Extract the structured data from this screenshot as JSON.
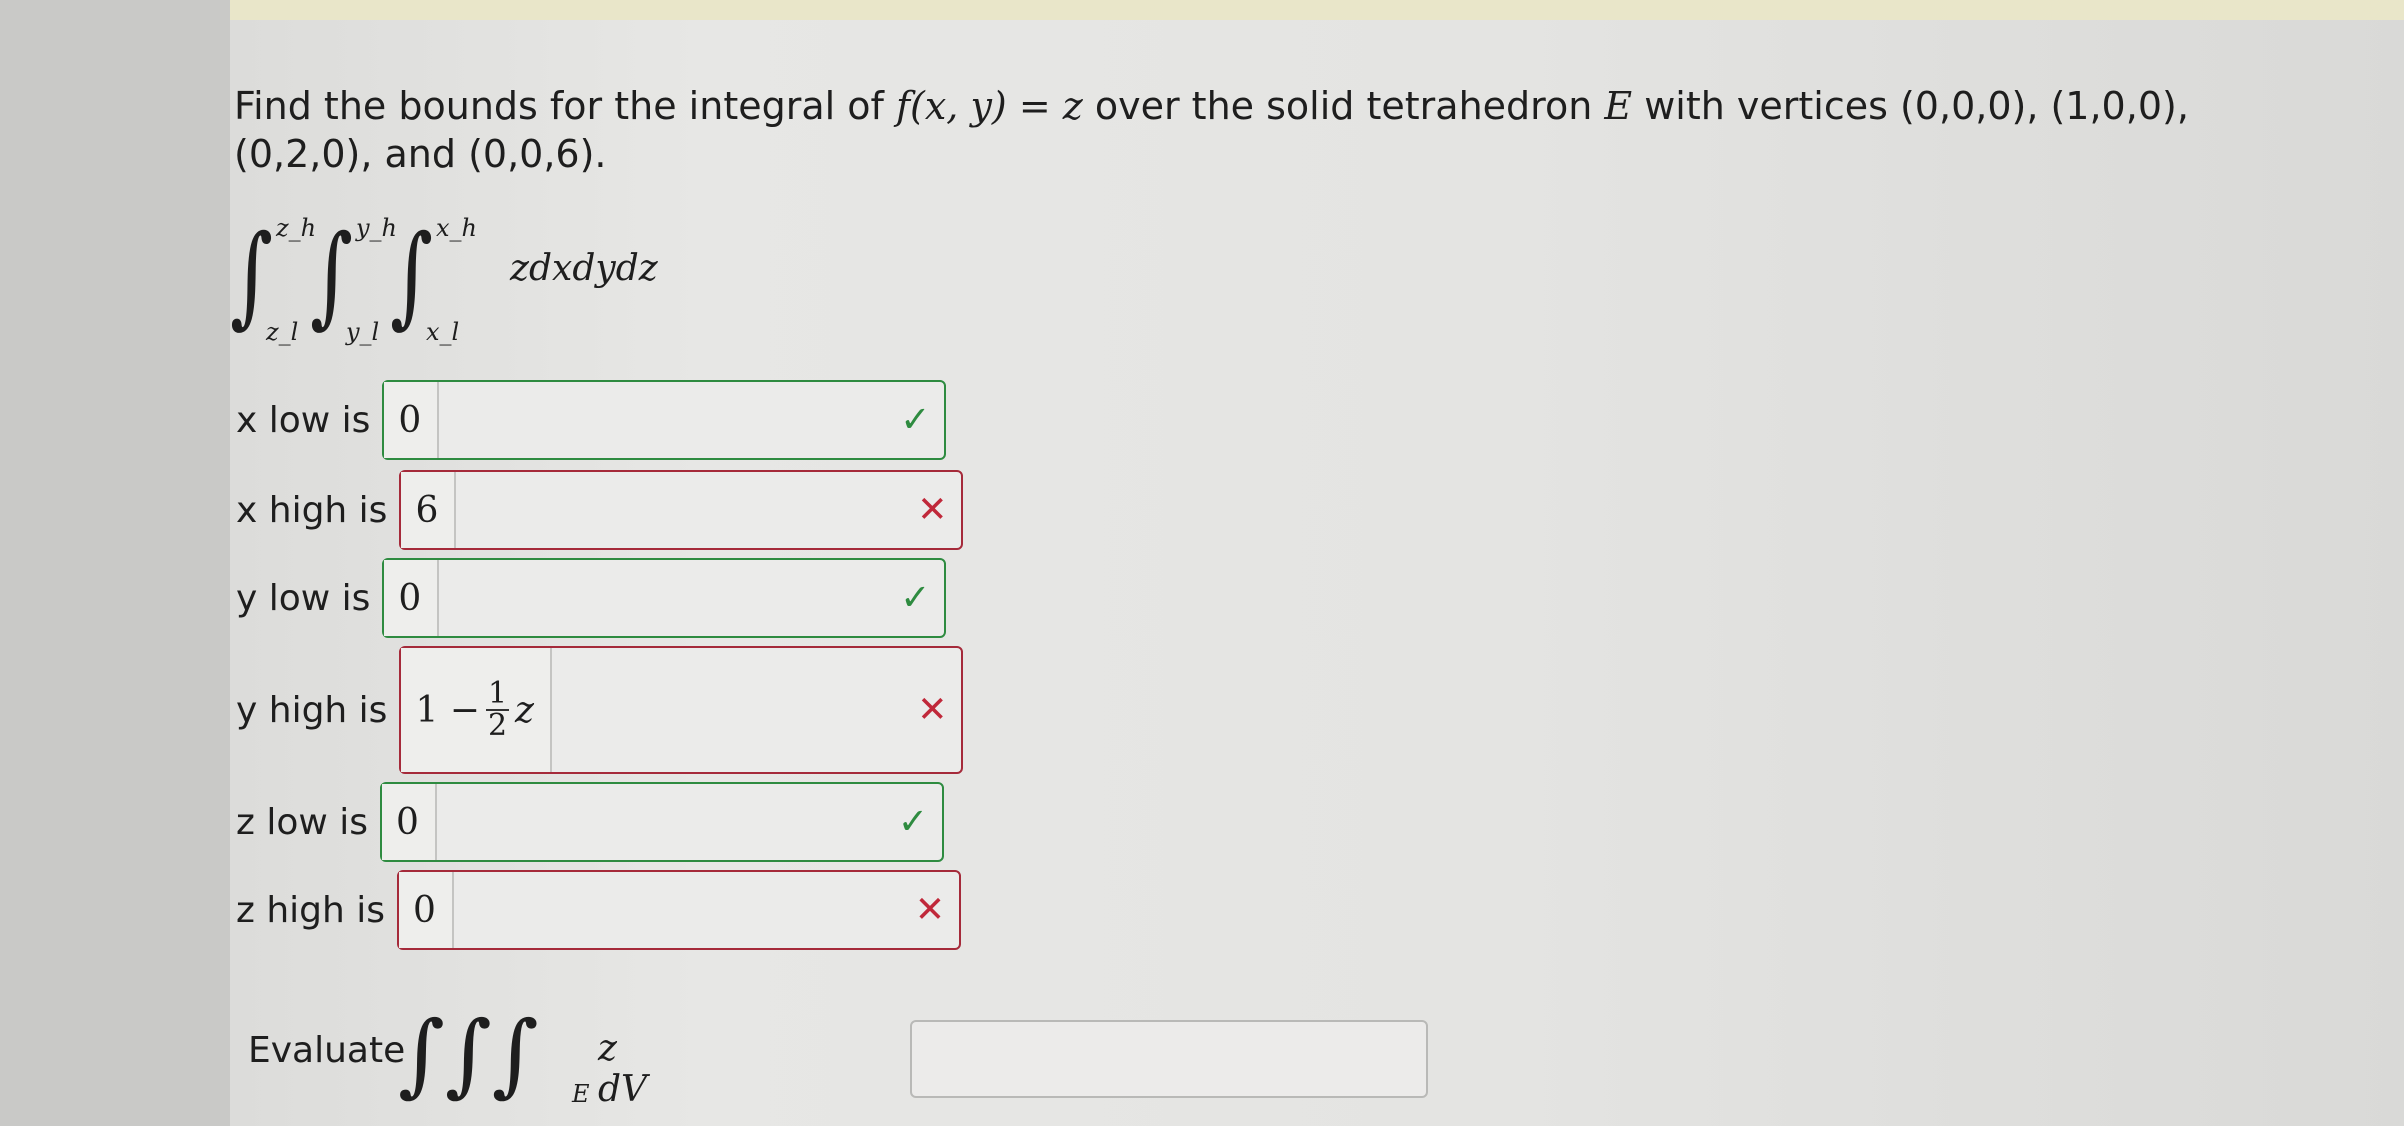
{
  "question": {
    "intro": "Find the bounds for the integral of ",
    "function": "f(x, y) = z",
    "mid": " over the solid tetrahedron ",
    "solid": "E",
    "vertices_text": " with vertices (0,0,0), (1,0,0), (0,2,0), and (0,0,6)."
  },
  "integral": {
    "z_upper": "z_h",
    "z_lower": "z_l",
    "y_upper": "y_h",
    "y_lower": "y_l",
    "x_upper": "x_h",
    "x_lower": "x_l",
    "integrand": "zdxdydz"
  },
  "fields": [
    {
      "label": "x low is",
      "value": "0",
      "status": "correct"
    },
    {
      "label": "x high is",
      "value": "6",
      "status": "incorrect"
    },
    {
      "label": "y low is",
      "value": "0",
      "status": "correct"
    },
    {
      "label": "y high is",
      "value_prefix": "1 −",
      "frac_num": "1",
      "frac_den": "2",
      "value_suffix": "z",
      "status": "incorrect"
    },
    {
      "label": "z low is",
      "value": "0",
      "status": "correct"
    },
    {
      "label": "z high is",
      "value": "0",
      "status": "incorrect"
    }
  ],
  "marks": {
    "correct": "✓",
    "incorrect": "✕"
  },
  "evaluate": {
    "label": "Evaluate",
    "integral_symbol": "∫∫∫",
    "region": "E",
    "integrand": "z dV",
    "input_value": ""
  },
  "colors": {
    "correct": "#2e8b40",
    "incorrect": "#a52a3a"
  }
}
